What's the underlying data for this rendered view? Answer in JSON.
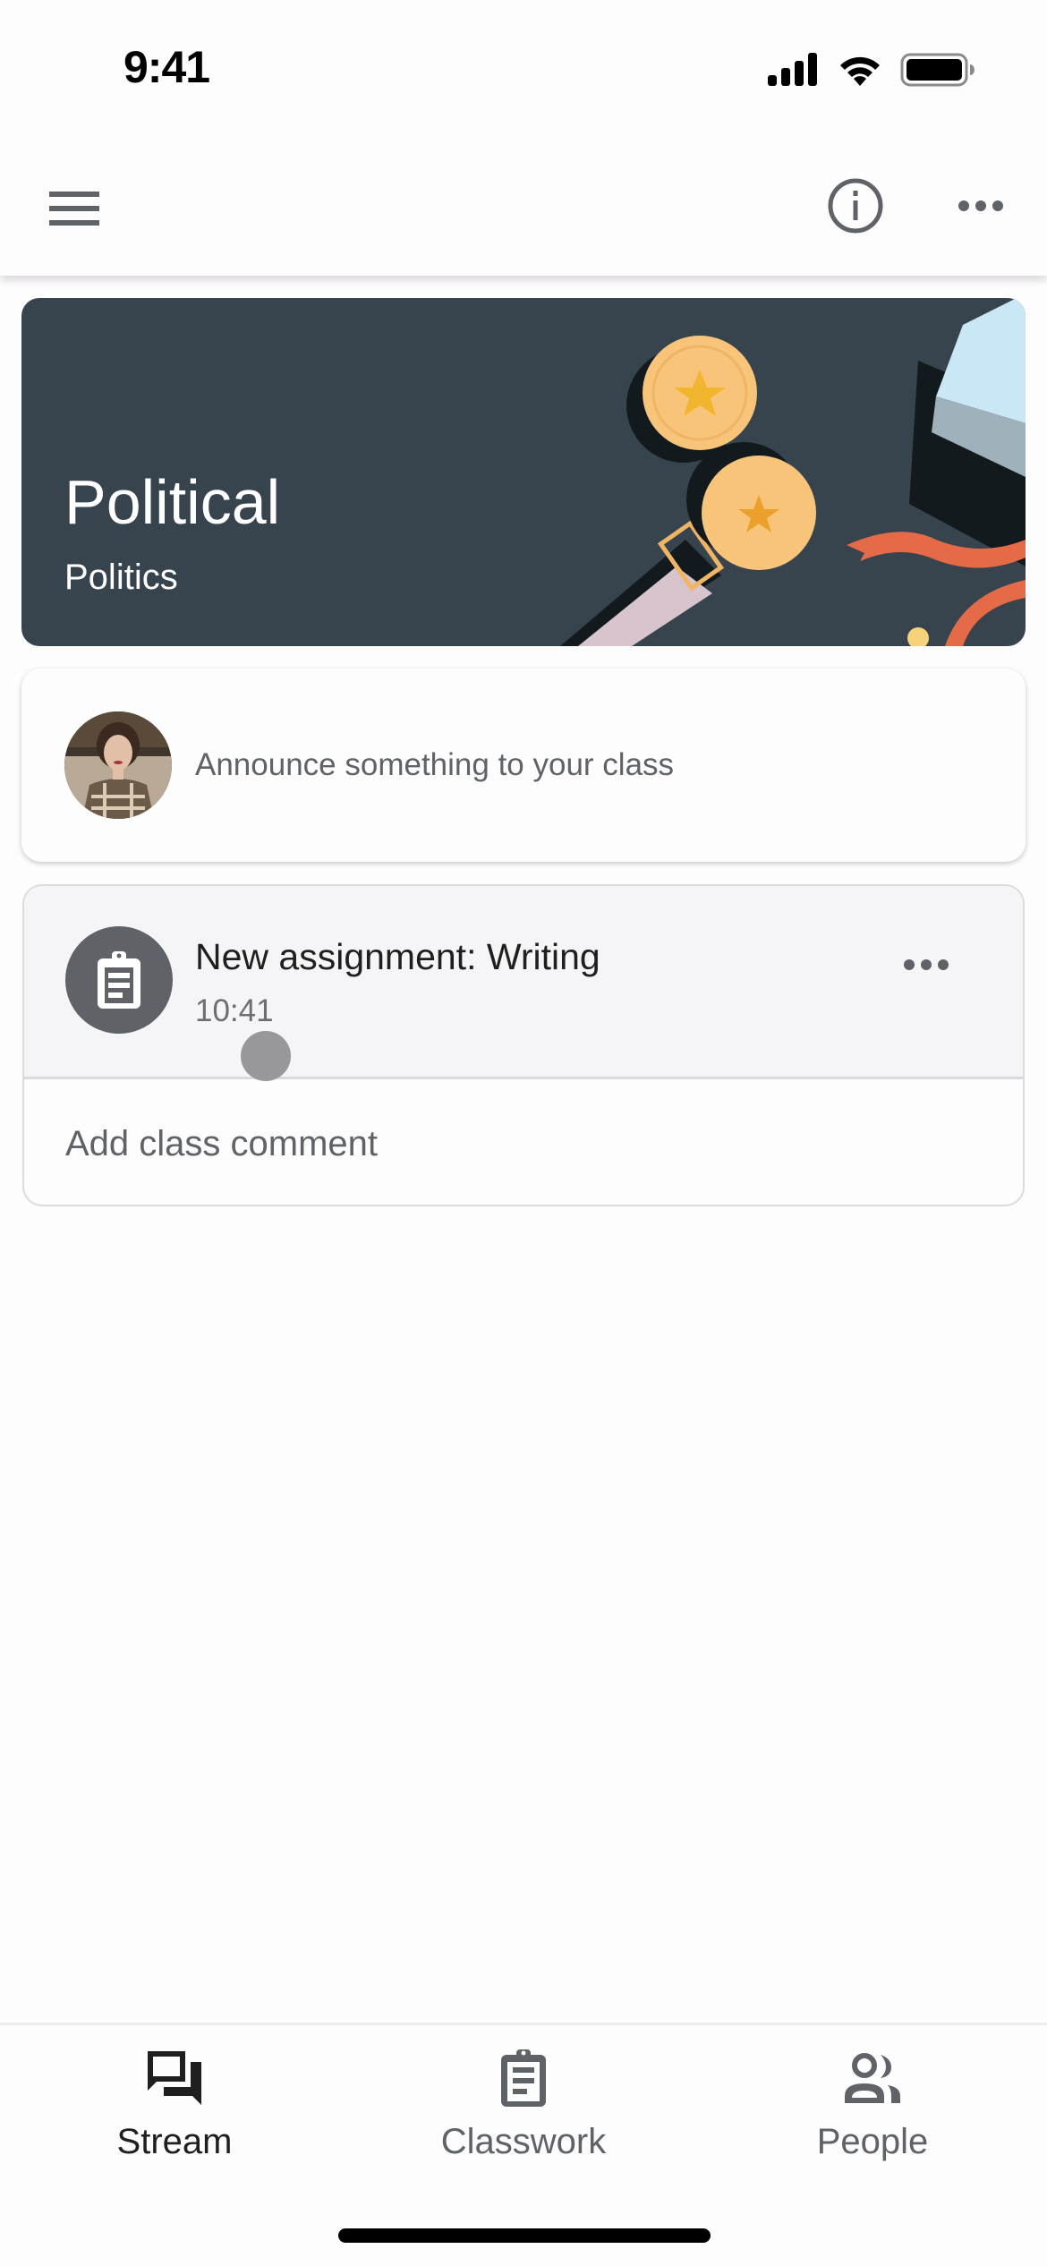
{
  "status_bar": {
    "time": "9:41",
    "icons": [
      "cellular-signal-icon",
      "wifi-icon",
      "battery-icon"
    ]
  },
  "app_bar": {
    "menu_icon": "hamburger-menu-icon",
    "info_icon": "info-circle-icon",
    "more_icon": "more-horizontal-icon"
  },
  "banner": {
    "title": "Political",
    "subtitle": "Politics",
    "background_color": "#37444e"
  },
  "announce": {
    "placeholder": "Announce something to your class",
    "avatar": "user-avatar"
  },
  "posts": [
    {
      "icon": "assignment-clipboard-icon",
      "title": "New assignment: Writing",
      "time": "10:41",
      "more_icon": "more-horizontal-icon",
      "comment_placeholder": "Add class comment"
    }
  ],
  "bottom_nav": {
    "items": [
      {
        "label": "Stream",
        "icon": "stream-chat-icon",
        "active": true
      },
      {
        "label": "Classwork",
        "icon": "classwork-clipboard-icon",
        "active": false
      },
      {
        "label": "People",
        "icon": "people-icon",
        "active": false
      }
    ]
  },
  "colors": {
    "icon_gray": "#5f6368",
    "active_text": "#1f1f1f",
    "post_header_bg": "#f5f4f7"
  }
}
